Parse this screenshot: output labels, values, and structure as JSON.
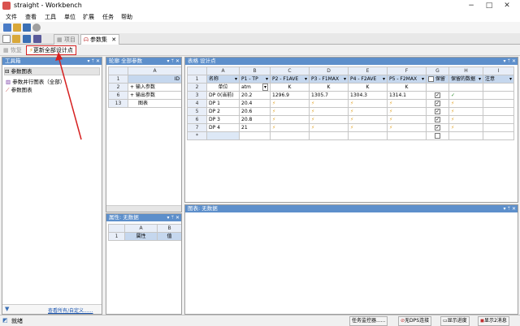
{
  "window": {
    "title": "straight - Workbench"
  },
  "menu": [
    "文件",
    "查看",
    "工具",
    "单位",
    "扩展",
    "任务",
    "帮助"
  ],
  "tabs": [
    {
      "label": "项目"
    },
    {
      "label": "参数集"
    }
  ],
  "toolbar2": {
    "restore": "恢复",
    "update_all": "更新全部设计点"
  },
  "toolbox": {
    "title": "工具箱",
    "section": "参数图表",
    "items": [
      "参数并行图表（全部）",
      "参数图表"
    ],
    "footer": "查看所有/自定义......"
  },
  "outline": {
    "title": "轮廓 全部参数",
    "col_headers": [
      "A"
    ],
    "rows": [
      {
        "num": "1",
        "cell": "ID"
      },
      {
        "num": "2",
        "cell": "输入参数",
        "expand": "+"
      },
      {
        "num": "6",
        "cell": "输出参数",
        "expand": "+"
      },
      {
        "num": "13",
        "cell": "图表"
      }
    ]
  },
  "properties": {
    "title": "属性: 无数据",
    "col_headers": [
      "A",
      "B"
    ],
    "row_num": "1",
    "cells": [
      "属性",
      "值"
    ]
  },
  "table": {
    "title": "表格 设计点",
    "col_letters": [
      "A",
      "B",
      "C",
      "D",
      "E",
      "F",
      "G",
      "H",
      "I"
    ],
    "headers": [
      "名称",
      "P1 - TP",
      "P2 - F1AVE",
      "P3 - F1MAX",
      "P4 - F2AVE",
      "P5 - F2MAX",
      "保留",
      "保留的数据",
      "注意"
    ],
    "units": [
      "单位",
      "atm",
      "K",
      "K",
      "K",
      "K",
      "",
      "",
      ""
    ],
    "rows": [
      {
        "num": "3",
        "name": "DP 0(当前)",
        "p1": "20.2",
        "p2": "1296.9",
        "p3": "1305.7",
        "p4": "1304.3",
        "p5": "1314.1"
      },
      {
        "num": "4",
        "name": "DP 1",
        "p1": "20.4"
      },
      {
        "num": "5",
        "name": "DP 2",
        "p1": "20.6"
      },
      {
        "num": "6",
        "name": "DP 3",
        "p1": "20.8"
      },
      {
        "num": "7",
        "name": "DP 4",
        "p1": "21"
      }
    ],
    "new_row": "*"
  },
  "chart_panel": {
    "title": "图表: 无数据"
  },
  "status": {
    "left": "就绪",
    "buttons": [
      "任务监控器......",
      "无DPS连接",
      "显示进度",
      "显示2消息"
    ]
  },
  "colors": {
    "panel_header": "#5d8fcb",
    "annotation_arrow": "#d62020"
  }
}
